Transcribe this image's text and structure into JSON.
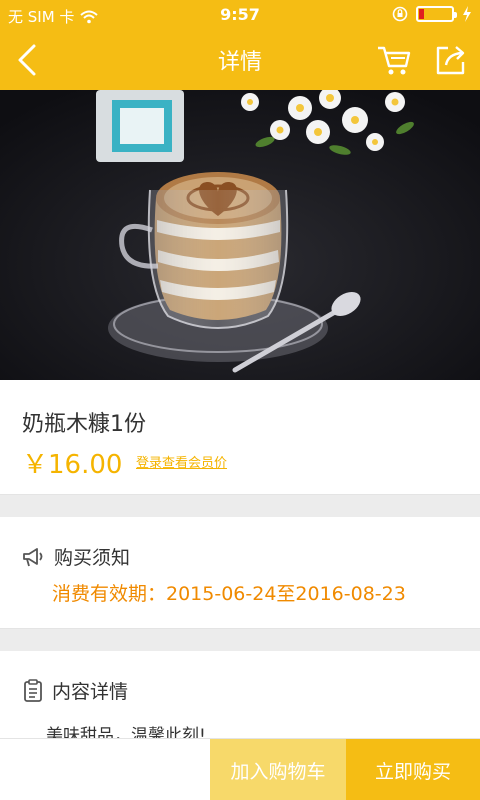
{
  "status_bar": {
    "carrier": "无 SIM 卡",
    "time": "9:57",
    "battery_level": 0.15,
    "icons": [
      "wifi-icon",
      "rotation-lock-icon",
      "battery-icon",
      "charging-icon"
    ]
  },
  "header": {
    "title": "详情",
    "icons": [
      "back-arrow-icon",
      "cart-icon",
      "share-icon"
    ]
  },
  "product": {
    "name": "奶瓶木糠1份",
    "price": "￥16.00",
    "member_price_link": "登录查看会员价"
  },
  "purchase_notice": {
    "heading": "购买须知",
    "validity": "消费有效期：2015-06-24至2016-08-23"
  },
  "content_details": {
    "heading": "内容详情",
    "description": "美味甜品，温馨此刻!"
  },
  "actions": {
    "add_to_cart": "加入购物车",
    "buy_now": "立即购买"
  },
  "colors": {
    "brand_yellow": "#f5bd14",
    "price_yellow": "#f5b400",
    "validity_orange": "#f08a00",
    "add_cart_bg": "#f7d96a"
  }
}
